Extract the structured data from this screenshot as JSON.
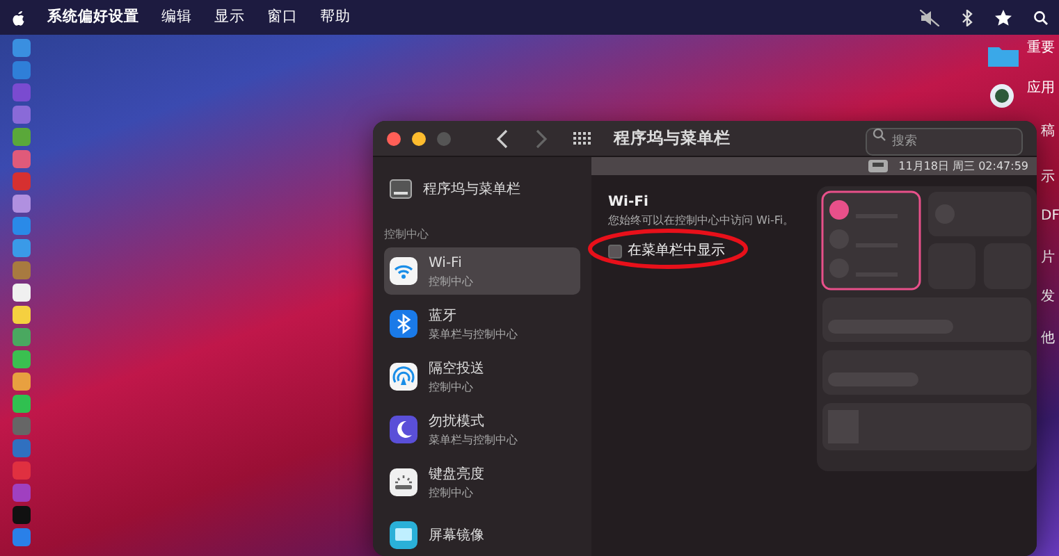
{
  "menubar": {
    "app_name": "系统偏好设置",
    "menus": [
      "编辑",
      "显示",
      "窗口",
      "帮助"
    ]
  },
  "window": {
    "title": "程序坞与菜单栏",
    "history": [
      {
        "kind": "back",
        "disabled": false
      },
      {
        "kind": "forward",
        "disabled": true
      }
    ],
    "search": {
      "placeholder": "搜索"
    },
    "sidebar": {
      "top_item": {
        "label": "程序坞与菜单栏"
      },
      "section": "控制中心",
      "items": [
        {
          "title": "Wi-Fi",
          "subtitle": "控制中心",
          "selected": true
        },
        {
          "title": "蓝牙",
          "subtitle": "菜单栏与控制中心",
          "selected": false
        },
        {
          "title": "隔空投送",
          "subtitle": "控制中心",
          "selected": false
        },
        {
          "title": "勿扰模式",
          "subtitle": "菜单栏与控制中心",
          "selected": false
        },
        {
          "title": "键盘亮度",
          "subtitle": "控制中心",
          "selected": false
        },
        {
          "title": "屏幕镜像",
          "selected": false
        }
      ]
    },
    "content": {
      "preview_clock": "11月18日 周三 02:47:59",
      "heading": "Wi-Fi",
      "description": "您始终可以在控制中心中访问 Wi-Fi。",
      "checkbox": {
        "label": "在菜单栏中显示",
        "checked": false
      }
    }
  },
  "desktop_items": [
    "重要",
    "应用",
    "稿",
    "示",
    "DF",
    "片",
    "发",
    "他"
  ]
}
